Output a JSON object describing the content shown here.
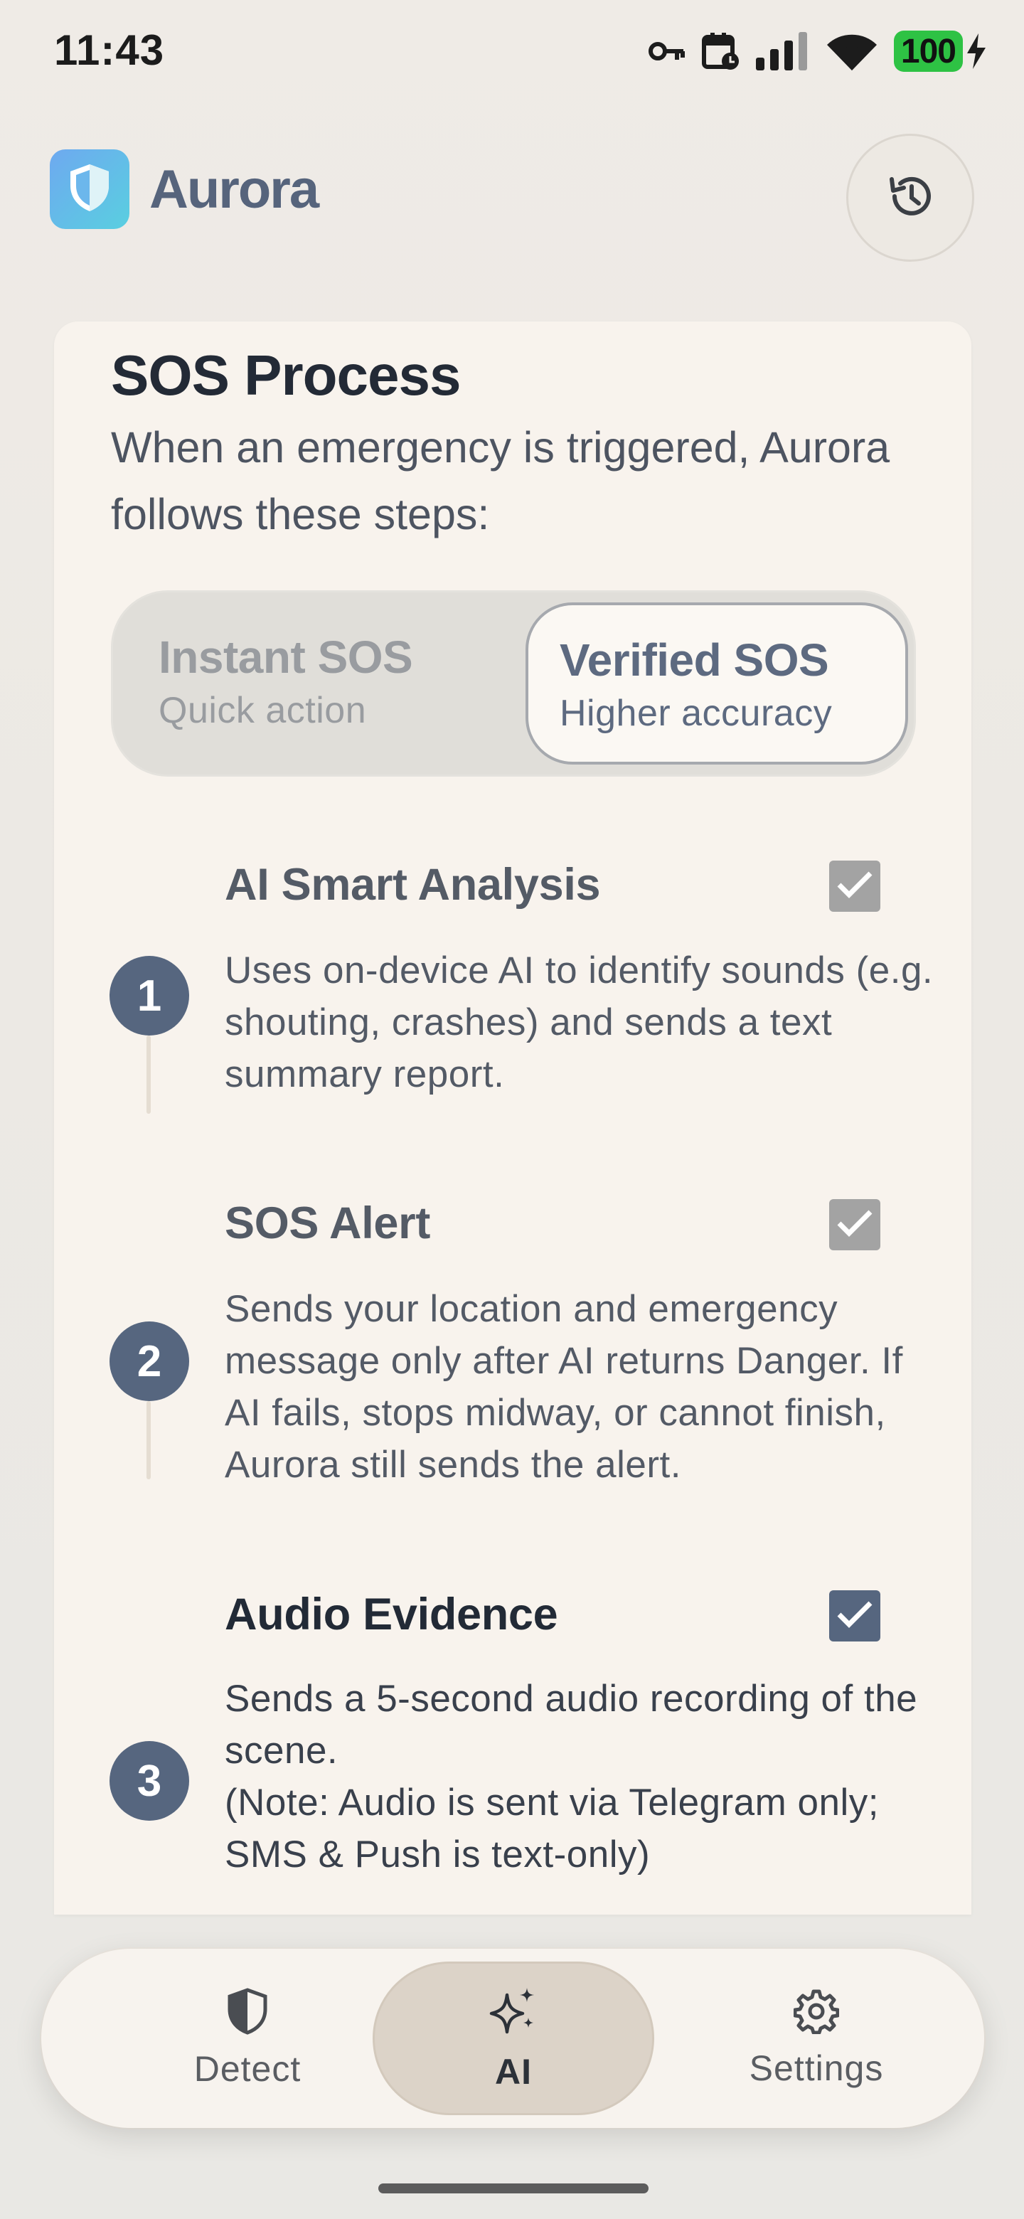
{
  "status_bar": {
    "time": "11:43",
    "battery": "100",
    "icons": [
      "key-icon",
      "calendar-icon",
      "signal-icon",
      "wifi-icon",
      "battery-icon",
      "charging-icon"
    ]
  },
  "header": {
    "app_name": "Aurora",
    "logo_icon": "shield-icon",
    "history_icon": "history-icon"
  },
  "card": {
    "title": "SOS Process",
    "description": "When an emergency is triggered, Aurora follows these steps:"
  },
  "mode_toggle": {
    "selected": "verified",
    "options": [
      {
        "id": "instant",
        "label": "Instant SOS",
        "sub": "Quick action"
      },
      {
        "id": "verified",
        "label": "Verified SOS",
        "sub": "Higher accuracy"
      }
    ]
  },
  "steps": [
    {
      "num": "1",
      "title": "AI Smart Analysis",
      "text": "Uses on-device AI to identify sounds (e.g. shouting, crashes) and sends a text summary report.",
      "checked": true,
      "active": false
    },
    {
      "num": "2",
      "title": "SOS Alert",
      "text": "Sends your location and emergency message only after AI returns Danger. If AI fails, stops midway, or cannot finish, Aurora still sends the alert.",
      "checked": true,
      "active": false
    },
    {
      "num": "3",
      "title": "Audio Evidence",
      "text_line1": "Sends a 5-second audio recording of the scene.",
      "text_line2": "(Note: Audio is sent via Telegram only; SMS & Push is text-only)",
      "checked": true,
      "active": true
    }
  ],
  "nav": {
    "selected": "ai",
    "items": [
      {
        "id": "detect",
        "label": "Detect",
        "icon": "shield-icon"
      },
      {
        "id": "ai",
        "label": "AI",
        "icon": "sparkles-icon"
      },
      {
        "id": "settings",
        "label": "Settings",
        "icon": "gear-icon"
      }
    ]
  },
  "colors": {
    "accent": "#56667f",
    "battery": "#2ec244",
    "background": "#efebe6",
    "card": "#f8f3ed"
  }
}
